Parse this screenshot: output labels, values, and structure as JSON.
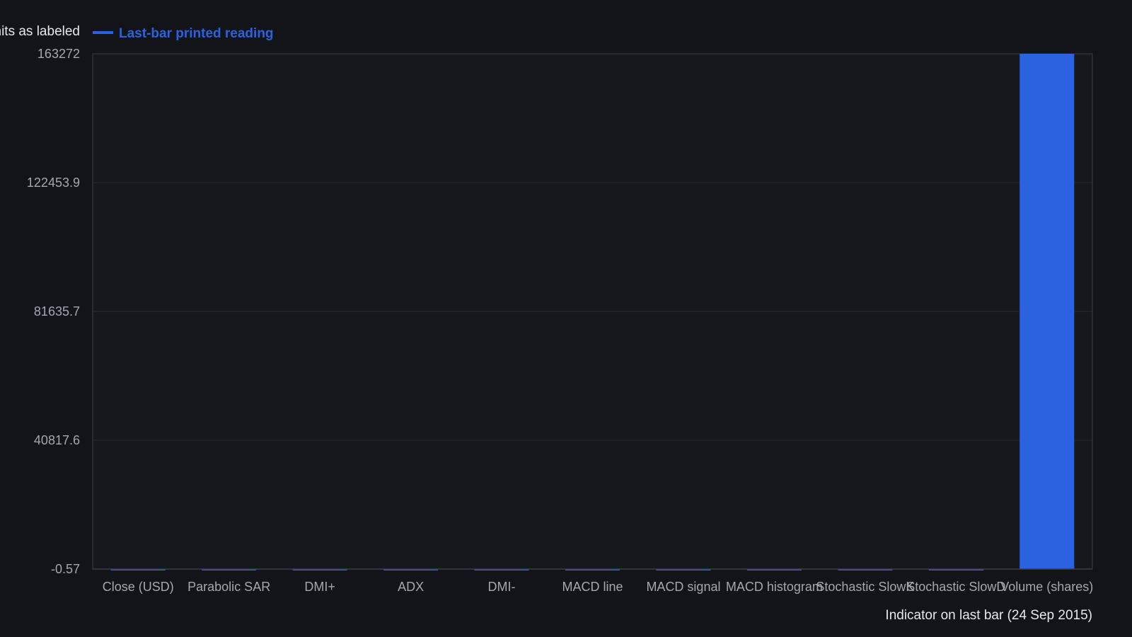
{
  "chart_data": {
    "type": "bar",
    "legend_prefix": "Units as labeled",
    "legend_position": "top-left",
    "series": [
      {
        "name": "Last-bar printed reading",
        "color": "#2b62e0",
        "values": [
          0,
          0,
          0,
          0,
          0,
          0,
          0,
          0,
          0,
          0,
          163272
        ]
      }
    ],
    "categories": [
      "Close (USD)",
      "Parabolic SAR",
      "DMI+",
      "ADX",
      "DMI-",
      "MACD line",
      "MACD signal",
      "MACD histogram",
      "Stochastic SlowK",
      "Stochastic SlowD",
      "Volume (shares)"
    ],
    "xlabel": "Indicator on last bar (24 Sep 2015)",
    "ylabel": "",
    "ylim": [
      -0.57,
      163272
    ],
    "yticks": [
      "-0.57",
      "40817.6",
      "81635.7",
      "122453.9",
      "163272"
    ],
    "grid": true,
    "colors": {
      "background": "#12141a",
      "plot_background": "#16181e",
      "grid": "#262932",
      "axis": "#3a3e48",
      "tick_text": "#a3a7b0",
      "title_text": "#e6e8ec"
    }
  }
}
